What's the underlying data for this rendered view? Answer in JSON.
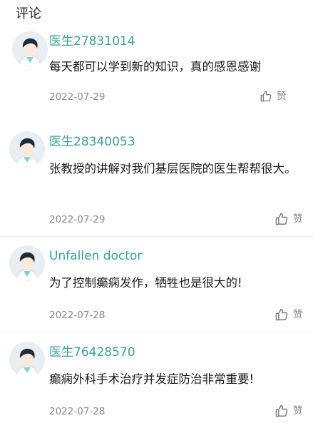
{
  "header": {
    "title": "评论"
  },
  "like_label": "赞",
  "comments": [
    {
      "user": "医生27831014",
      "text": "每天都可以学到新的知识，真的感恩感谢",
      "date": "2022-07-29"
    },
    {
      "user": "医生28340053",
      "text": "张教授的讲解对我们基层医院的医生帮帮很大。",
      "date": "2022-07-29"
    },
    {
      "user": "Unfallen doctor",
      "text": "为了控制癫痫发作，牺牲也是很大的!",
      "date": "2022-07-28"
    },
    {
      "user": "医生76428570",
      "text": "癫痫外科手术治疗并发症防治非常重要!",
      "date": "2022-07-28"
    }
  ],
  "colors": {
    "username": "#3aa192",
    "avatar_hair": "#1e2a36",
    "avatar_shirt": "#7fd6c6"
  }
}
